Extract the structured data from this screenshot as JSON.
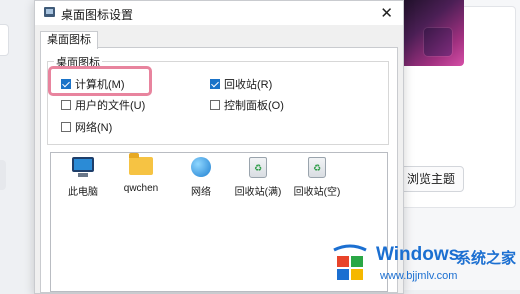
{
  "dialog": {
    "title": "桌面图标设置",
    "close": "✕",
    "tab": "桌面图标",
    "group_title": "桌面图标",
    "checkboxes": [
      {
        "label": "计算机(M)",
        "checked": true
      },
      {
        "label": "回收站(R)",
        "checked": true
      },
      {
        "label": "用户的文件(U)",
        "checked": false
      },
      {
        "label": "控制面板(O)",
        "checked": false
      },
      {
        "label": "网络(N)",
        "checked": false
      }
    ],
    "icons": [
      {
        "name": "monitor-icon",
        "label": "此电脑"
      },
      {
        "name": "folder-icon",
        "label": "qwchen"
      },
      {
        "name": "network-globe-icon",
        "label": "网络"
      },
      {
        "name": "recycle-bin-full-icon",
        "label": "回收站(满)"
      },
      {
        "name": "recycle-bin-empty-icon",
        "label": "回收站(空)"
      }
    ]
  },
  "background": {
    "browse_button": "浏览主题"
  },
  "watermark": {
    "brand": "Windows",
    "cn": "系统之家",
    "url": "www.bjjmlv.com"
  },
  "colors": {
    "highlight": "#e8849e",
    "check_accent": "#1a73c8",
    "watermark": "#1b6fd1"
  }
}
